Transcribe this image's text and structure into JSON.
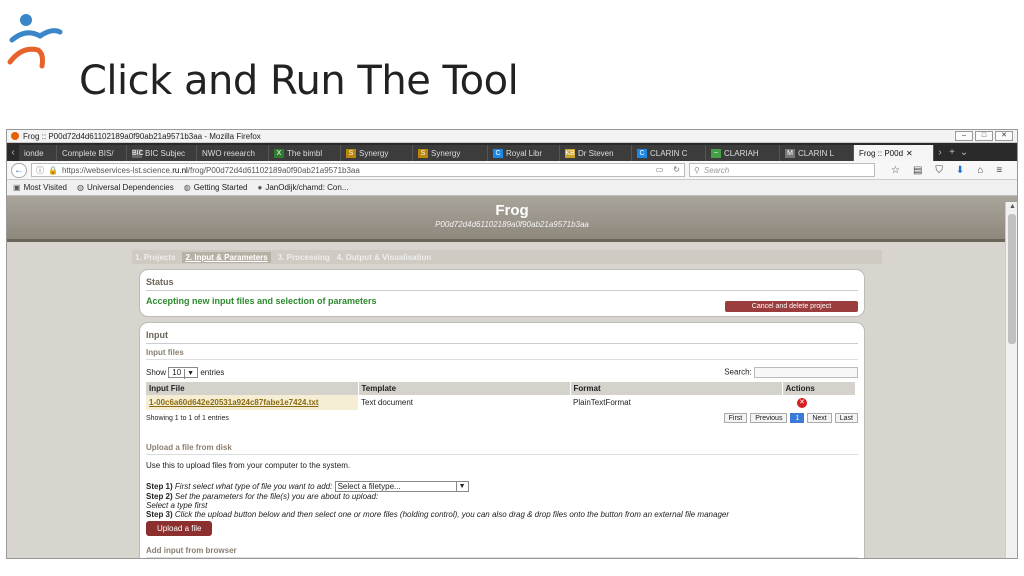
{
  "slide": {
    "title": "Click and Run The Tool"
  },
  "window": {
    "title": "Frog :: P00d72d4d61102189a0f90ab21a9571b3aa - Mozilla Firefox"
  },
  "tabs": [
    {
      "label": "ionde",
      "icon": ""
    },
    {
      "label": "Complete BIS/",
      "icon": ""
    },
    {
      "label": "BIC Subjec",
      "icon": "BIC"
    },
    {
      "label": "NWO research",
      "icon": ""
    },
    {
      "label": "The bimbl",
      "icon": "X"
    },
    {
      "label": "Synergy",
      "icon": "S"
    },
    {
      "label": "Synergy",
      "icon": "S"
    },
    {
      "label": "Royal Libr",
      "icon": "C"
    },
    {
      "label": "Dr Steven",
      "icon": "KB"
    },
    {
      "label": "CLARIN C",
      "icon": "C"
    },
    {
      "label": "CLARIAH",
      "icon": "~"
    },
    {
      "label": "CLARIN L",
      "icon": "M"
    },
    {
      "label": "Frog :: P00d",
      "icon": "",
      "active": true,
      "close": "✕"
    }
  ],
  "navbar": {
    "url_prefix": "https://webservices-lst.science.",
    "url_domain": "ru.nl",
    "url_suffix": "/frog/P00d72d4d61102189a0f90ab21a9571b3aa",
    "search_placeholder": "Search"
  },
  "bookmarks": [
    {
      "label": "Most Visited"
    },
    {
      "label": "Universal Dependencies"
    },
    {
      "label": "Getting Started"
    },
    {
      "label": "JanOdijk/chamd: Con..."
    }
  ],
  "app": {
    "name": "Frog",
    "project_id": "P00d72d4d61102189a0f90ab21a9571b3aa",
    "steps": [
      "1. Projects",
      "2. Input & Parameters",
      "3. Processing",
      "4. Output & Visualisation"
    ],
    "status": {
      "heading": "Status",
      "message": "Accepting new input files and selection of parameters",
      "cancel_label": "Cancel and delete project"
    },
    "input": {
      "heading": "Input",
      "files_heading": "Input files",
      "show_label": "Show",
      "entries_value": "10",
      "entries_label": "entries",
      "search_label": "Search:",
      "columns": [
        "Input File",
        "Template",
        "Format",
        "Actions"
      ],
      "rows": [
        {
          "file": "1-00c6a60d642e20531a924c87fabe1e7424.txt",
          "template": "Text document",
          "format": "PlainTextFormat"
        }
      ],
      "showing": "Showing 1 to 1 of 1 entries",
      "pager": [
        "First",
        "Previous",
        "1",
        "Next",
        "Last"
      ],
      "upload_heading": "Upload a file from disk",
      "upload_desc": "Use this to upload files from your computer to the system.",
      "step1_label": "Step 1)",
      "step1_text": "First select what type of file you want to add:",
      "filetype_select": "Select a filetype...",
      "step2_label": "Step 2)",
      "step2_text": "Set the parameters for the file(s) you are about to upload:",
      "select_type_first": "Select a type first",
      "step3_label": "Step 3)",
      "step3_text": "Click the upload button below and then select one or more files (holding control), you can also drag & drop files onto the button from an external file manager",
      "upload_button": "Upload a file",
      "browser_heading": "Add input from browser"
    }
  },
  "colors": {
    "status_green": "#2d8a2d",
    "button_red": "#8b2f2f",
    "logo_blue": "#3a86c8",
    "logo_orange": "#e8632b"
  }
}
